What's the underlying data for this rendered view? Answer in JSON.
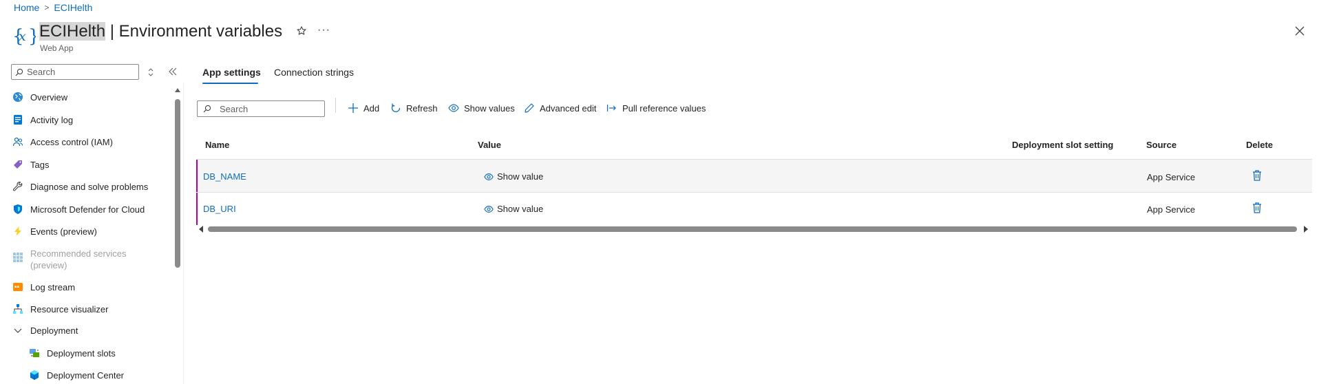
{
  "breadcrumb": {
    "home": "Home",
    "separator": ">",
    "current": "ECIHelth"
  },
  "header": {
    "resource_icon": "variable-braces-icon",
    "resource_name": "ECIHelth",
    "title_rest": " | Environment variables",
    "subtitle": "Web App",
    "star_icon": "star-icon",
    "more": "···",
    "close_icon": "close-icon"
  },
  "sidebar": {
    "search_placeholder": "Search",
    "items": [
      {
        "label": "Overview",
        "icon": "globe-icon"
      },
      {
        "label": "Activity log",
        "icon": "activity-log-icon"
      },
      {
        "label": "Access control (IAM)",
        "icon": "people-icon"
      },
      {
        "label": "Tags",
        "icon": "tag-icon"
      },
      {
        "label": "Diagnose and solve problems",
        "icon": "wrench-icon"
      },
      {
        "label": "Microsoft Defender for Cloud",
        "icon": "shield-icon"
      },
      {
        "label": "Events (preview)",
        "icon": "lightning-icon"
      },
      {
        "label": "Recommended services",
        "label2": "(preview)",
        "icon": "grid-icon",
        "disabled": true
      },
      {
        "label": "Log stream",
        "icon": "log-stream-icon"
      },
      {
        "label": "Resource visualizer",
        "icon": "hierarchy-icon"
      },
      {
        "label": "Deployment",
        "icon": "chevron-down-icon"
      },
      {
        "label": "Deployment slots",
        "icon": "slots-icon"
      },
      {
        "label": "Deployment Center",
        "icon": "cube-icon"
      }
    ]
  },
  "tabs": [
    {
      "label": "App settings",
      "active": true
    },
    {
      "label": "Connection strings",
      "active": false
    }
  ],
  "toolbar": {
    "search_placeholder": "Search",
    "add": "Add",
    "refresh": "Refresh",
    "show_values": "Show values",
    "advanced_edit": "Advanced edit",
    "pull_reference": "Pull reference values"
  },
  "table": {
    "columns": [
      "Name",
      "Value",
      "Deployment slot setting",
      "Source",
      "Delete"
    ],
    "rows": [
      {
        "name": "DB_NAME",
        "value": "Show value",
        "slot_setting": "",
        "source": "App Service"
      },
      {
        "name": "DB_URI",
        "value": "Show value",
        "slot_setting": "",
        "source": "App Service"
      }
    ]
  },
  "colors": {
    "accent": "#0f6cbd",
    "row_accent": "#b4009e",
    "delete": "#0f6cbd"
  }
}
